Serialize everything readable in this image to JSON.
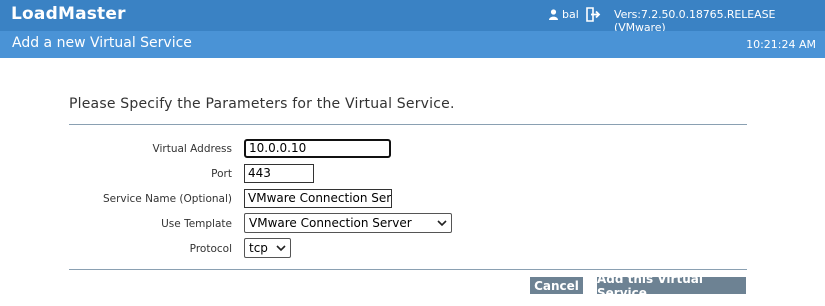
{
  "header": {
    "app_title": "LoadMaster",
    "user": "bal",
    "version": "Vers:7.2.50.0.18765.RELEASE (VMware)"
  },
  "subheader": {
    "title": "Add a new Virtual Service",
    "time": "10:21:24 AM"
  },
  "form": {
    "heading": "Please Specify the Parameters for the Virtual Service.",
    "virtual_address": {
      "label": "Virtual Address",
      "value": "10.0.0.10"
    },
    "port": {
      "label": "Port",
      "value": "443"
    },
    "service_name": {
      "label": "Service Name (Optional)",
      "value": "VMware Connection Ser"
    },
    "use_template": {
      "label": "Use Template",
      "selected": "VMware Connection Server"
    },
    "protocol": {
      "label": "Protocol",
      "selected": "tcp"
    }
  },
  "buttons": {
    "cancel": "Cancel",
    "add": "Add this Virtual Service"
  },
  "colors": {
    "topbar": "#3a82c4",
    "subbar": "#4a93d6",
    "button": "#6d8293"
  },
  "icons": [
    "user-icon",
    "logout-icon",
    "chevron-down-icon"
  ]
}
